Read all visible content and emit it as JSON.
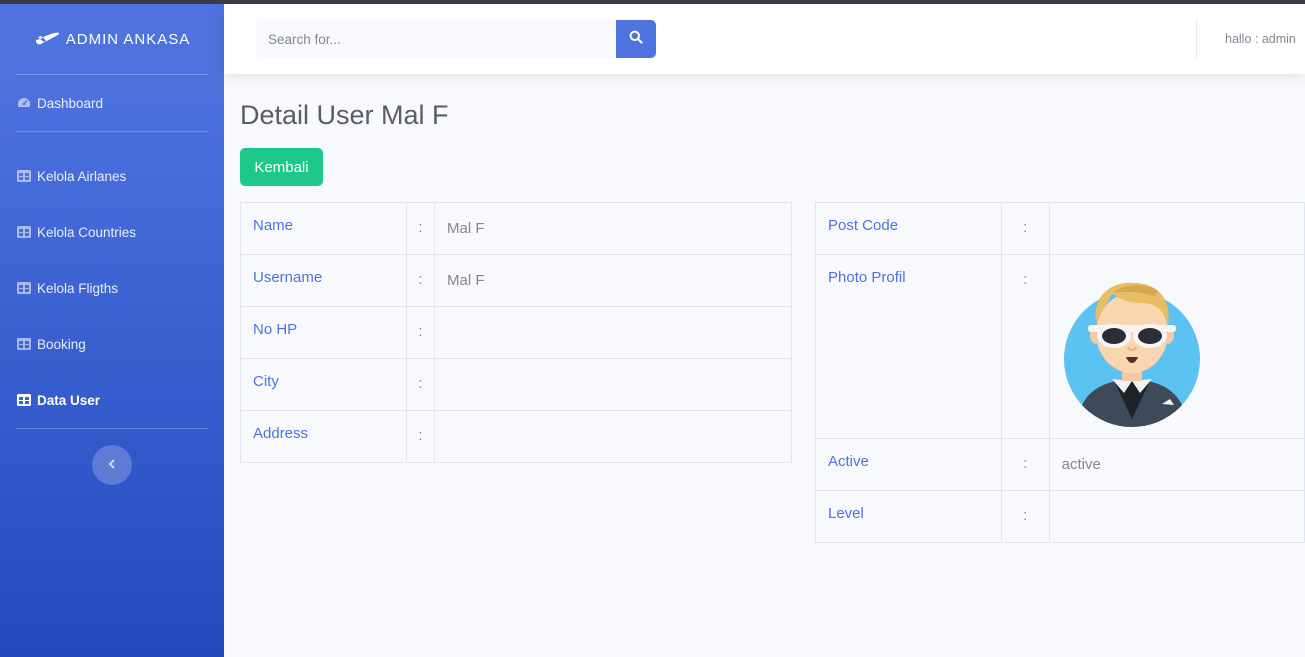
{
  "brand": {
    "title": "ADMIN ANKASA",
    "icon": "plane-icon"
  },
  "sidebar": {
    "items": [
      {
        "label": "Dashboard",
        "icon": "tachometer-icon",
        "active": false
      },
      {
        "label": "Kelola Airlanes",
        "icon": "table-icon",
        "active": false
      },
      {
        "label": "Kelola Countries",
        "icon": "table-icon",
        "active": false
      },
      {
        "label": "Kelola Fligths",
        "icon": "table-icon",
        "active": false
      },
      {
        "label": "Booking",
        "icon": "table-icon",
        "active": false
      },
      {
        "label": "Data User",
        "icon": "table-icon",
        "active": true
      }
    ],
    "toggle_icon": "chevron-left-icon"
  },
  "topbar": {
    "search_placeholder": "Search for...",
    "search_icon": "search-icon",
    "greeting": "hallo : admin"
  },
  "page": {
    "title": "Detail User Mal F",
    "back_label": "Kembali"
  },
  "detail_left": [
    {
      "label": "Name",
      "sep": ":",
      "value": "Mal F"
    },
    {
      "label": "Username",
      "sep": ":",
      "value": "Mal F"
    },
    {
      "label": "No HP",
      "sep": ":",
      "value": ""
    },
    {
      "label": "City",
      "sep": ":",
      "value": ""
    },
    {
      "label": "Address",
      "sep": ":",
      "value": ""
    }
  ],
  "detail_right": [
    {
      "label": "Post Code",
      "sep": ":",
      "value": ""
    },
    {
      "label": "Photo Profil",
      "sep": ":",
      "value": ""
    },
    {
      "label": "Active",
      "sep": ":",
      "value": "active"
    },
    {
      "label": "Level",
      "sep": ":",
      "value": ""
    }
  ],
  "colors": {
    "primary": "#4e73df",
    "success": "#1cc88a",
    "text_muted": "#858796",
    "heading": "#5a5c69",
    "avatar_bg": "#5bc2f2"
  }
}
